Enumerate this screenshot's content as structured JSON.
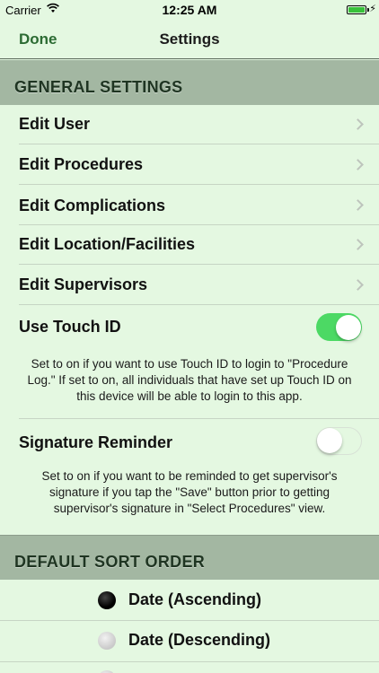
{
  "status_bar": {
    "carrier": "Carrier",
    "time": "12:25 AM",
    "battery_color": "#38c13a"
  },
  "nav": {
    "done_label": "Done",
    "title": "Settings",
    "accent_color": "#2c6b33"
  },
  "general": {
    "header": "GENERAL SETTINGS",
    "items": [
      {
        "label": "Edit User",
        "icon": "chevron-right-icon"
      },
      {
        "label": "Edit Procedures",
        "icon": "chevron-right-icon"
      },
      {
        "label": "Edit Complications",
        "icon": "chevron-right-icon"
      },
      {
        "label": "Edit Location/Facilities",
        "icon": "chevron-right-icon"
      },
      {
        "label": "Edit Supervisors",
        "icon": "chevron-right-icon"
      }
    ],
    "touch_id": {
      "label": "Use Touch ID",
      "on": true,
      "description": "Set to on if you want to use Touch ID to login to \"Procedure Log.\"  If set to on, all individuals that have set up Touch ID on this device will be able to login to this app."
    },
    "signature_reminder": {
      "label": "Signature Reminder",
      "on": false,
      "description": "Set to on if you want to be reminded to get supervisor's signature if you tap the \"Save\" button prior to getting supervisor's signature in \"Select Procedures\" view."
    }
  },
  "sort_order": {
    "header": "DEFAULT SORT ORDER",
    "options": [
      {
        "label": "Date (Ascending)",
        "selected": true
      },
      {
        "label": "Date (Descending)",
        "selected": false
      }
    ]
  },
  "colors": {
    "background": "#e4f8e1",
    "section_header": "#a3b7a2",
    "toggle_on": "#4cd964"
  }
}
